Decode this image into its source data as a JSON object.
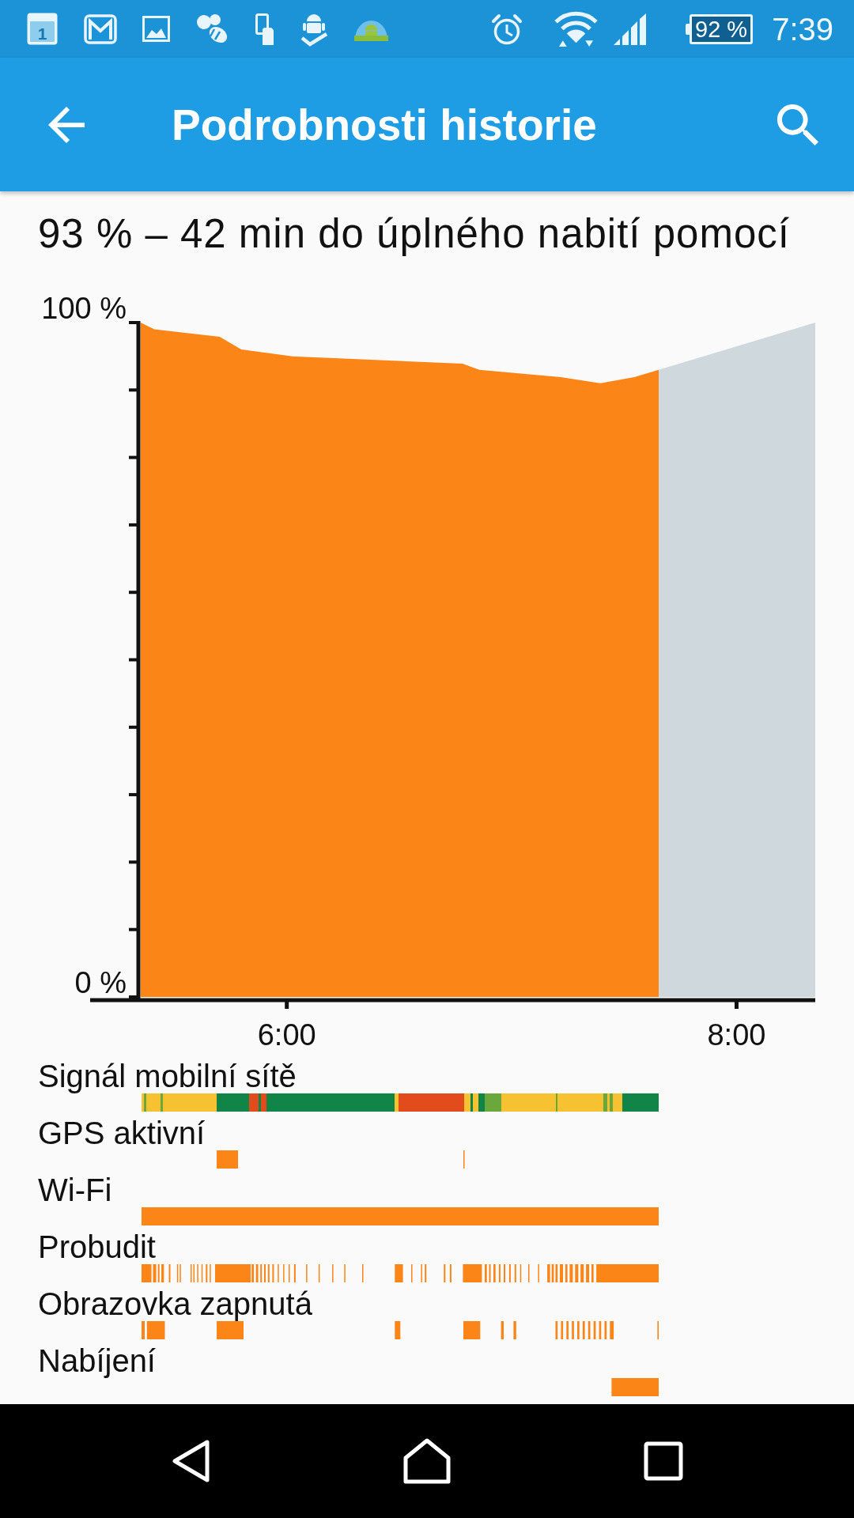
{
  "status_bar": {
    "calendar_day": "1",
    "battery": "92 %",
    "time": "7:39"
  },
  "app_bar": {
    "title": "Podrobnosti historie"
  },
  "summary": "93 % – 42 min do úplného nabití pomocí",
  "chart": {
    "chart_data": {
      "type": "area",
      "x": [
        5.35,
        5.411,
        5.702,
        5.742,
        5.798,
        6.026,
        6.782,
        6.856,
        7.218,
        7.394,
        7.545,
        7.654,
        8.35
      ],
      "series": [
        {
          "color": "#fc8518",
          "values": [
            100,
            99,
            97.9,
            97.1,
            96,
            95,
            93.9,
            93,
            91.9,
            91,
            91.9,
            93,
            null
          ]
        },
        {
          "color": "#cfd8dc",
          "values": [
            null,
            null,
            null,
            null,
            null,
            null,
            null,
            null,
            null,
            null,
            null,
            93,
            100
          ]
        }
      ],
      "xlim": [
        5.34,
        8.35
      ],
      "ylim": [
        0,
        100
      ],
      "xticks": [
        {
          "value": 6,
          "label": "6:00"
        },
        {
          "value": 8,
          "label": "8:00"
        }
      ],
      "yticks": [
        {
          "value": 0,
          "label": "0 %"
        },
        {
          "value": 100,
          "label": "100 %"
        }
      ]
    }
  },
  "timeline": [
    {
      "label": "Signál mobilní sítě",
      "kind": "signal"
    },
    {
      "label": "GPS aktivní",
      "kind": "activity"
    },
    {
      "label": "Wi-Fi",
      "kind": "activity"
    },
    {
      "label": "Probudit",
      "kind": "activity"
    },
    {
      "label": "Obrazovka zapnutá",
      "kind": "activity"
    },
    {
      "label": "Nabíjení",
      "kind": "activity"
    }
  ]
}
